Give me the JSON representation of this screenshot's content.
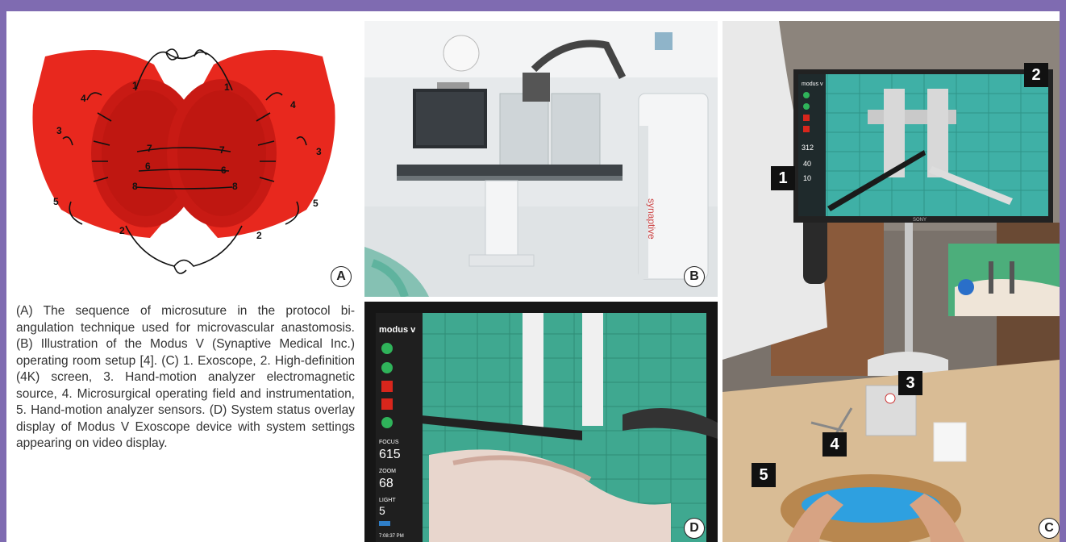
{
  "panel_a": {
    "letter": "A",
    "labels": {
      "l1a": "1",
      "l1b": "1",
      "l2a": "2",
      "l2b": "2",
      "l3a": "3",
      "l3b": "3",
      "l4a": "4",
      "l4b": "4",
      "l5a": "5",
      "l5b": "5",
      "l6a": "6",
      "l6b": "6",
      "l7a": "7",
      "l7b": "7",
      "l8a": "8",
      "l8b": "8"
    }
  },
  "panel_b": {
    "letter": "B",
    "brand": "synaptive"
  },
  "panel_c": {
    "letter": "C",
    "markers": {
      "m1": "1",
      "m2": "2",
      "m3": "3",
      "m4": "4",
      "m5": "5"
    },
    "screen_brand": "modus v",
    "readouts": {
      "r1": "312",
      "r2": "40",
      "r3": "10"
    },
    "monitor_brand": "SONY"
  },
  "panel_d": {
    "letter": "D",
    "brand": "modus v",
    "focus_label": "FOCUS",
    "focus_value": "615",
    "zoom_label": "ZOOM",
    "zoom_value": "68",
    "light_label": "LIGHT",
    "light_value": "5",
    "time": "7:08:37 PM"
  },
  "caption": "(A) The sequence of microsuture in the protocol bi-angulation technique used for microvascular anastomosis. (B) Illustration of the Modus V (Synaptive Medical Inc.) operating room setup [4]. (C) 1. Exoscope, 2. High-definition (4K) screen, 3. Hand-motion analyzer electromagnetic source, 4. Microsurgical operating field and instrumentation, 5. Hand-motion analyzer sensors. (D) System status overlay display of Modus V Exoscope device with system settings appearing on video display.",
  "colors": {
    "frame": "#7f6bb1",
    "vessel_red": "#e8281e",
    "mat_green": "#3aa68a"
  }
}
